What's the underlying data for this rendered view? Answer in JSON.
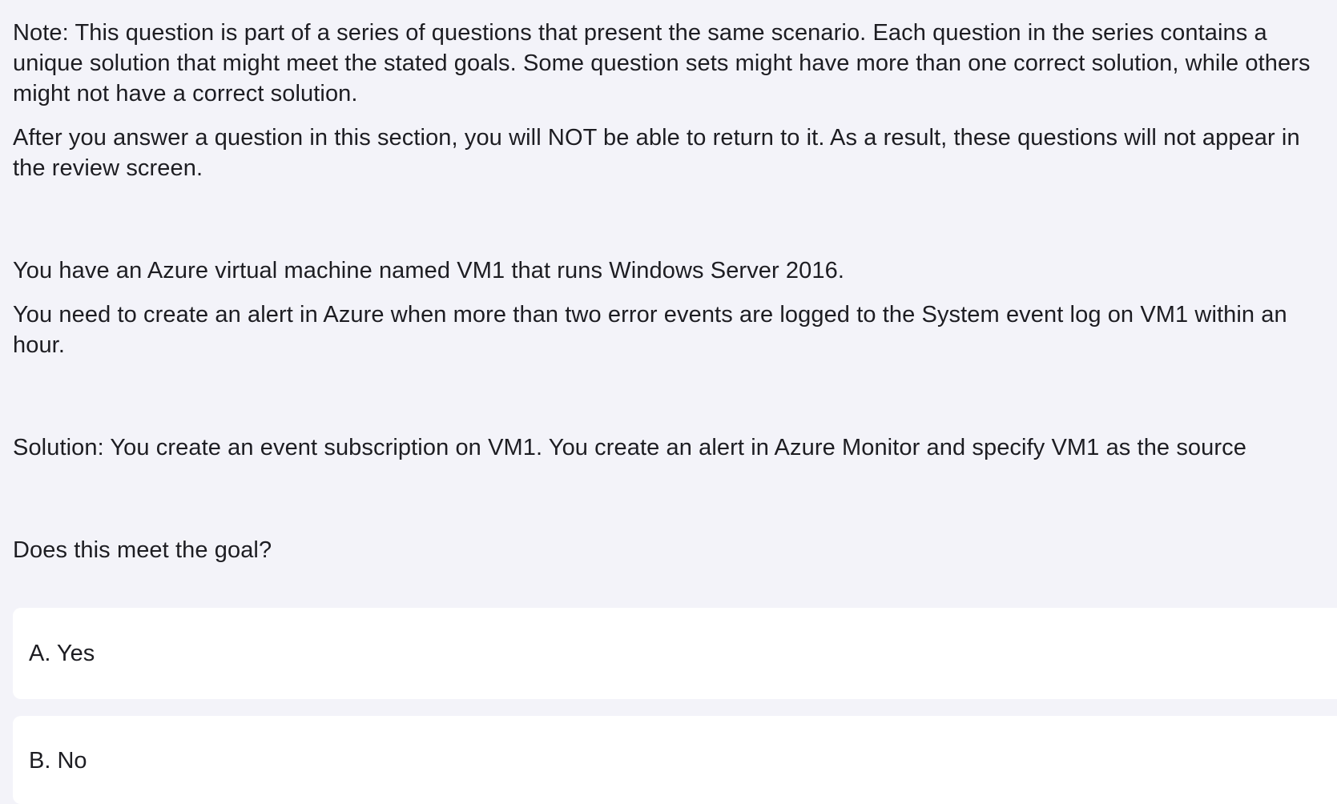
{
  "question": {
    "note": "Note: This question is part of a series of questions that present the same scenario. Each question in the series contains a unique solution that might meet the stated goals. Some question sets might have more than one correct solution, while others might not have a correct solution.",
    "after": "After you answer a question in this section, you will NOT be able to return to it. As a result, these questions will not appear in the review screen.",
    "vm": "You have an Azure virtual machine named VM1 that runs Windows Server 2016.",
    "need": "You need to create an alert in Azure when more than two error events are logged to the System event log on VM1 within an hour.",
    "solution": "Solution: You create an event subscription on VM1. You create an alert in Azure Monitor and specify VM1 as the source",
    "prompt": "Does this meet the goal?"
  },
  "options": [
    {
      "label": "A. Yes"
    },
    {
      "label": "B. No"
    }
  ]
}
